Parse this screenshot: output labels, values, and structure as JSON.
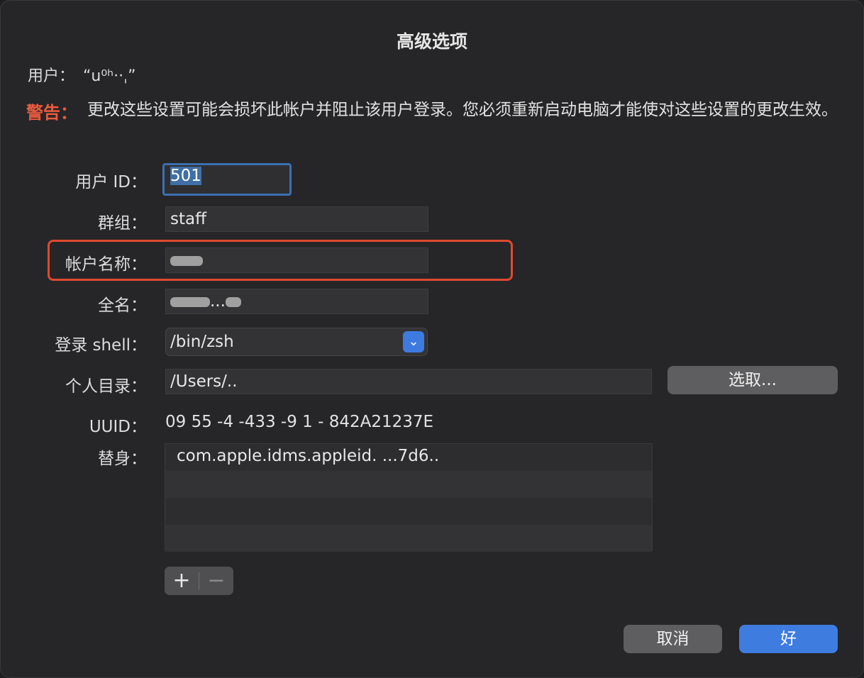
{
  "dialog": {
    "title": "高级选项",
    "user_label": "用户：",
    "user_value": "“u⁰ʰ··ˌ”",
    "warning_label": "警告：",
    "warning_text": "更改这些设置可能会损坏此帐户并阻止该用户登录。您必须重新启动电脑才能使对这些设置的更改生效。"
  },
  "fields": {
    "user_id": {
      "label": "用户 ID：",
      "value": "501"
    },
    "group": {
      "label": "群组：",
      "value": "staff"
    },
    "account_name": {
      "label": "帐户名称：",
      "value": ""
    },
    "full_name": {
      "label": "全名：",
      "value": "..."
    },
    "login_shell": {
      "label": "登录 shell：",
      "value": "/bin/zsh"
    },
    "home_dir": {
      "label": "个人目录：",
      "value": "/Users/..",
      "choose_label": "选取..."
    },
    "uuid": {
      "label": "UUID：",
      "value": "09  55  -4  -433  -9  1  -  842A21237E"
    },
    "alias": {
      "label": "替身：",
      "items": [
        "com.apple.idms.appleid.       ...7d6..",
        "",
        "",
        ""
      ]
    }
  },
  "controls": {
    "plus": "+",
    "minus": "−"
  },
  "buttons": {
    "cancel": "取消",
    "ok": "好"
  },
  "colors": {
    "accent": "#3e7ce0",
    "warning": "#ea5b3f",
    "highlight": "#e0492f"
  },
  "icons": {
    "select_chevron": "chevron-down-icon"
  }
}
